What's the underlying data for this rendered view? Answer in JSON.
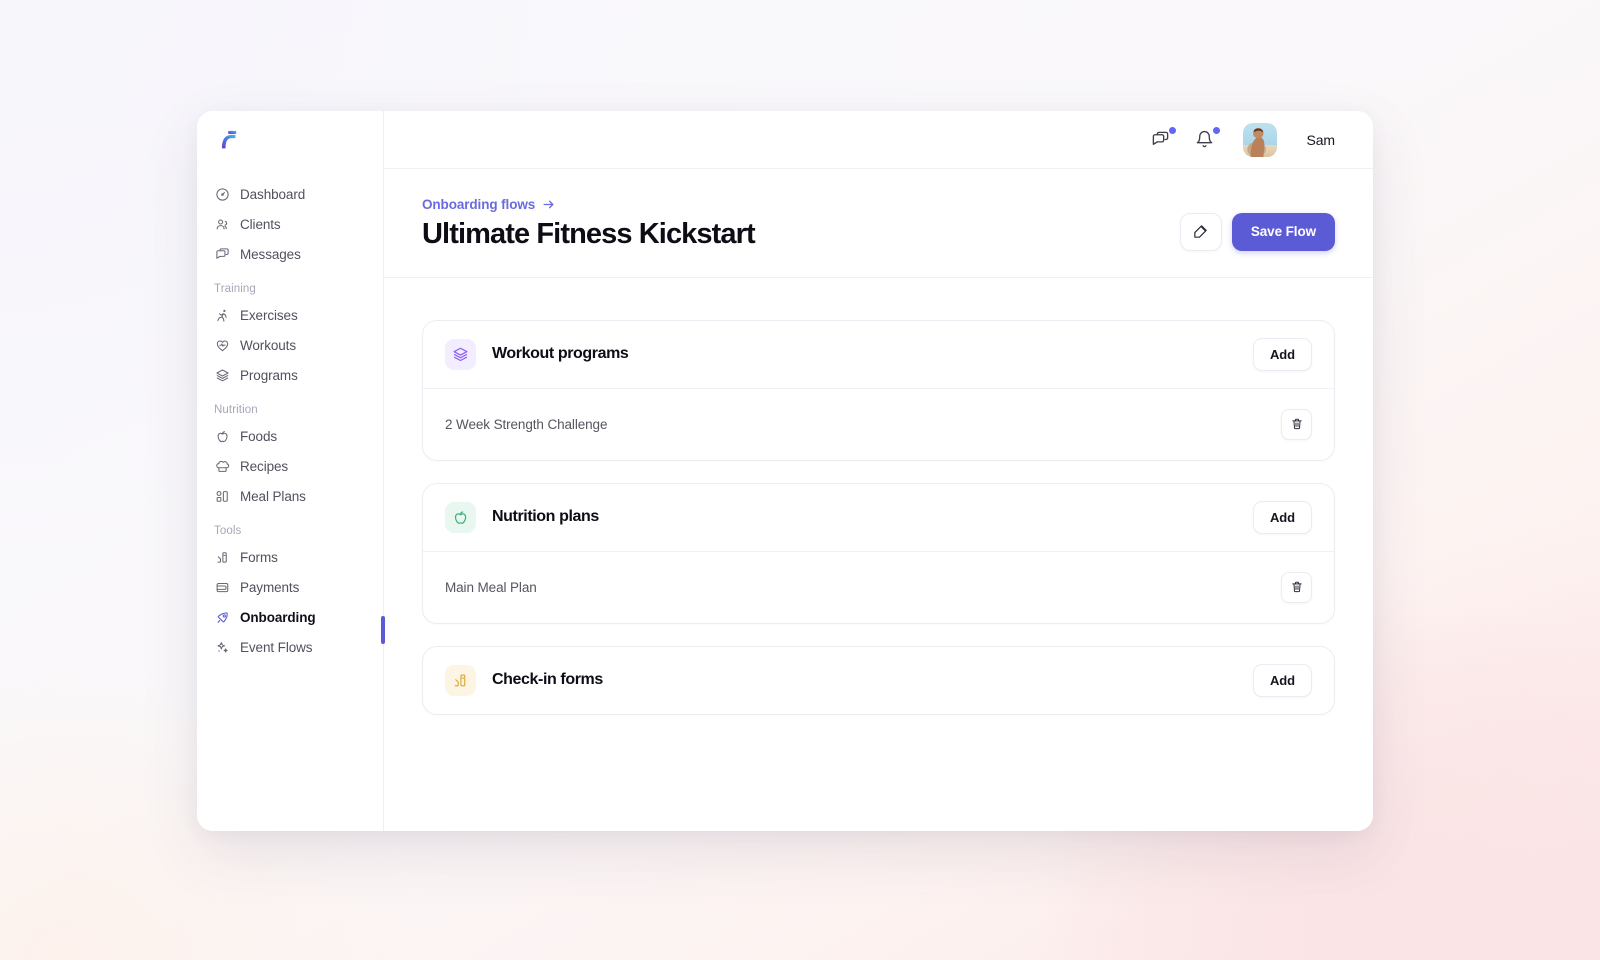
{
  "brand": {
    "logo": "fitness-f-logo",
    "accent": "#5b5bd6"
  },
  "sidebar": {
    "groups": [
      {
        "label": "",
        "items": [
          {
            "label": "Dashboard",
            "icon": "gauge-icon",
            "active": false
          },
          {
            "label": "Clients",
            "icon": "users-icon",
            "active": false
          },
          {
            "label": "Messages",
            "icon": "chat-icon",
            "active": false
          }
        ]
      },
      {
        "label": "Training",
        "items": [
          {
            "label": "Exercises",
            "icon": "runner-icon",
            "active": false
          },
          {
            "label": "Workouts",
            "icon": "heart-pulse-icon",
            "active": false
          },
          {
            "label": "Programs",
            "icon": "layers-icon",
            "active": false
          }
        ]
      },
      {
        "label": "Nutrition",
        "items": [
          {
            "label": "Foods",
            "icon": "apple-icon",
            "active": false
          },
          {
            "label": "Recipes",
            "icon": "chef-hat-icon",
            "active": false
          },
          {
            "label": "Meal Plans",
            "icon": "meal-grid-icon",
            "active": false
          }
        ]
      },
      {
        "label": "Tools",
        "items": [
          {
            "label": "Forms",
            "icon": "form-bars-icon",
            "active": false
          },
          {
            "label": "Payments",
            "icon": "wallet-icon",
            "active": false
          },
          {
            "label": "Onboarding",
            "icon": "rocket-icon",
            "active": true
          },
          {
            "label": "Event Flows",
            "icon": "sparkles-icon",
            "active": false
          }
        ]
      }
    ]
  },
  "topbar": {
    "messages_icon": "chat-icon",
    "notifications_icon": "bell-icon",
    "messages_has_badge": true,
    "notifications_has_badge": true,
    "avatar": "user-avatar",
    "user_name": "Sam"
  },
  "header": {
    "breadcrumb_label": "Onboarding flows",
    "breadcrumb_arrow": "arrow-right-icon",
    "title": "Ultimate Fitness Kickstart",
    "edit_icon": "pencil-square-icon",
    "save_label": "Save Flow"
  },
  "cards": [
    {
      "title": "Workout programs",
      "icon": "layers-icon",
      "icon_color": "#8b5cf6",
      "icon_bg": "#f3eeff",
      "add_label": "Add",
      "rows": [
        {
          "label": "2 Week Strength Challenge",
          "delete_icon": "trash-icon"
        }
      ]
    },
    {
      "title": "Nutrition plans",
      "icon": "apple-icon",
      "icon_color": "#3fae7f",
      "icon_bg": "#e8f8f0",
      "add_label": "Add",
      "rows": [
        {
          "label": "Main Meal Plan",
          "delete_icon": "trash-icon"
        }
      ]
    },
    {
      "title": "Check-in forms",
      "icon": "form-bars-icon",
      "icon_color": "#e0aa3e",
      "icon_bg": "#fdf5e3",
      "add_label": "Add",
      "rows": []
    }
  ]
}
